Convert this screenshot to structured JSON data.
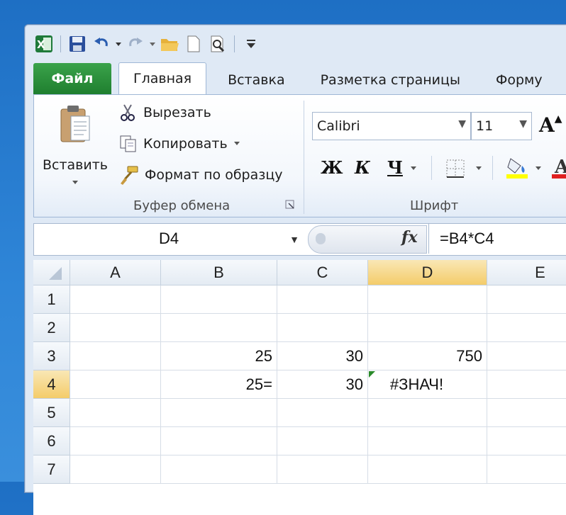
{
  "qat": {
    "icons": [
      "excel-app-icon",
      "save-icon",
      "undo-icon",
      "redo-icon",
      "open-folder-icon",
      "new-document-icon",
      "print-preview-icon",
      "customize-toolbar-icon"
    ]
  },
  "tabs": [
    {
      "label": "Файл"
    },
    {
      "label": "Главная"
    },
    {
      "label": "Вставка"
    },
    {
      "label": "Разметка страницы"
    },
    {
      "label": "Форму"
    }
  ],
  "clipboard": {
    "paste_label": "Вставить",
    "cut_label": "Вырезать",
    "copy_label": "Копировать",
    "format_painter_label": "Формат по образцу",
    "group_label": "Буфер обмена"
  },
  "font": {
    "font_name": "Calibri",
    "font_size": "11",
    "bold": "Ж",
    "italic": "К",
    "underline": "Ч",
    "grow": "A",
    "group_label": "Шрифт",
    "fill_color": "#ffff00",
    "font_color": "#e02020"
  },
  "formula_bar": {
    "name_box": "D4",
    "fx_label": "fx",
    "formula": "=B4*C4"
  },
  "columns": [
    "A",
    "B",
    "C",
    "D",
    "E"
  ],
  "rows": [
    "1",
    "2",
    "3",
    "4",
    "5",
    "6",
    "7"
  ],
  "cells": {
    "B3": "25",
    "C3": "30",
    "D3": "750",
    "B4": "25=",
    "C4": "30",
    "D4": "#ЗНАЧ!"
  }
}
